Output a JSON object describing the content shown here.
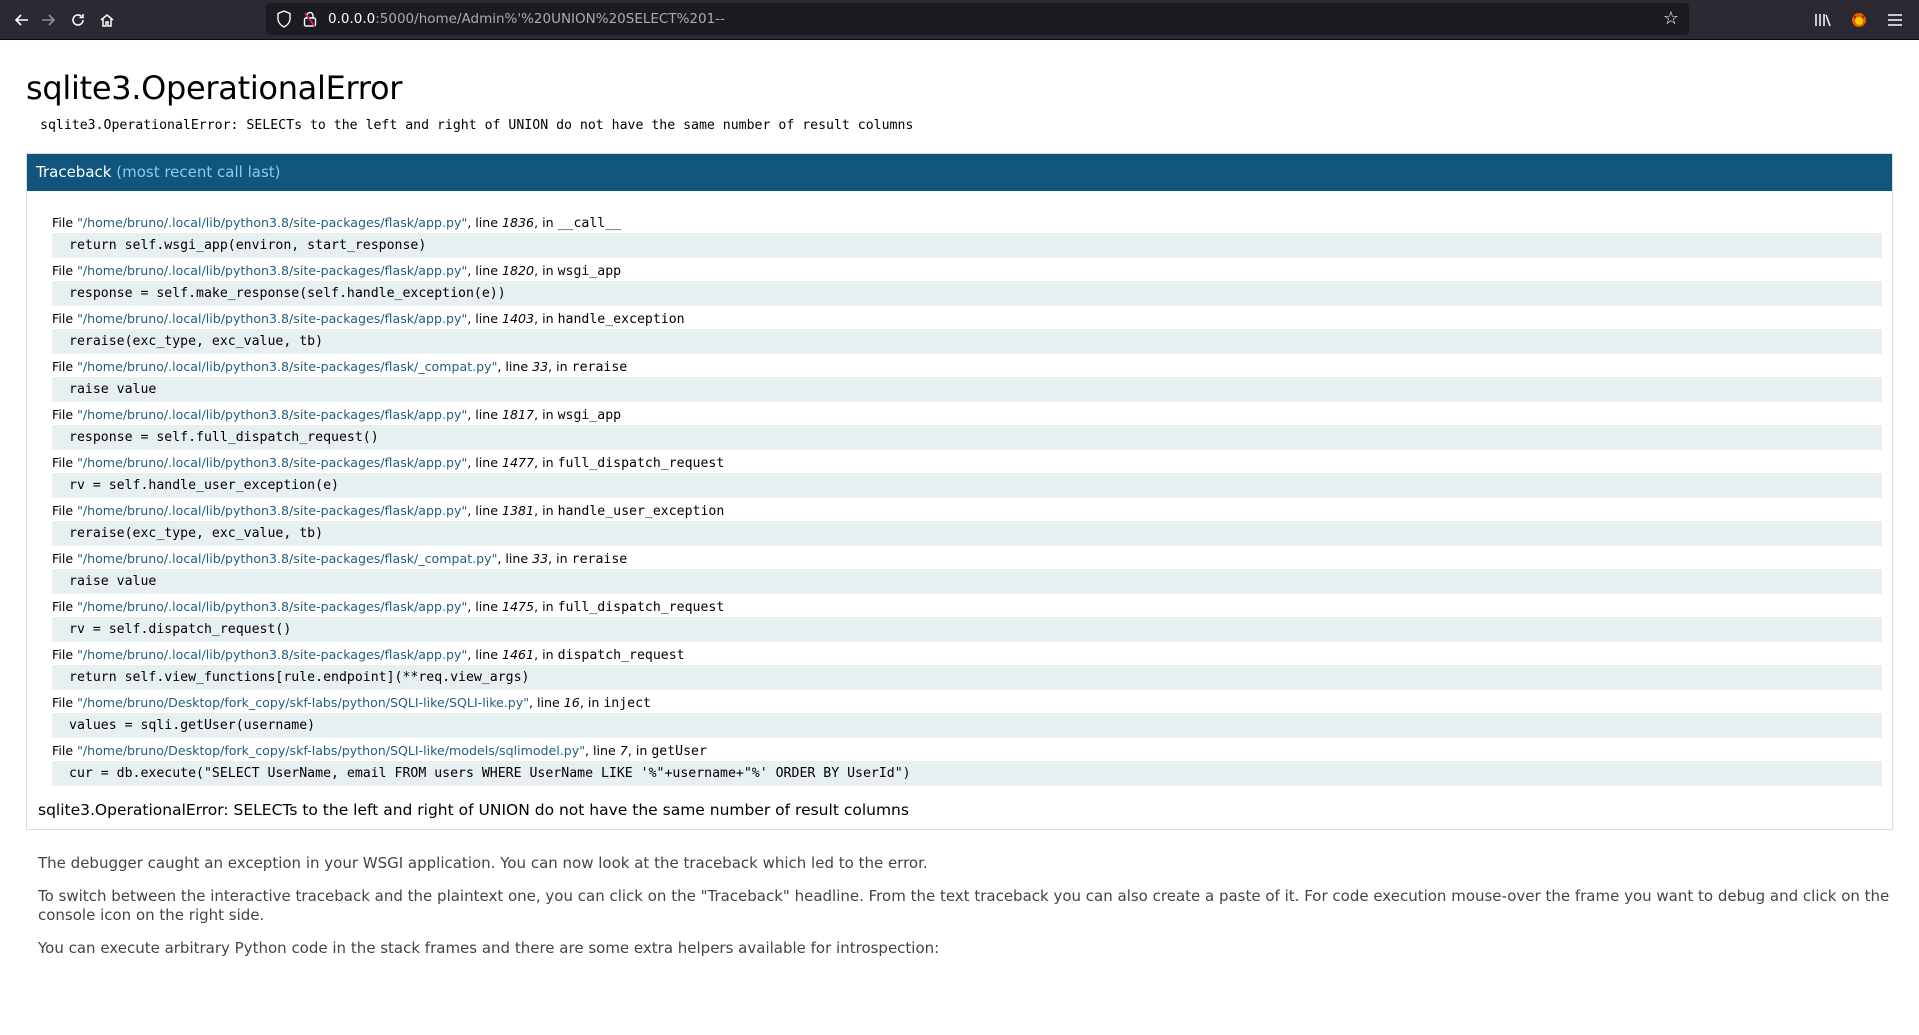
{
  "browser": {
    "url_host": "0.0.0.0",
    "url_rest": ":5000/home/Admin%'%20UNION%20SELECT%201--"
  },
  "page": {
    "title": "sqlite3.OperationalError",
    "error_message": "sqlite3.OperationalError: SELECTs to the left and right of UNION do not have the same number of result columns"
  },
  "traceback": {
    "header": "Traceback",
    "header_sub": "(most recent call last)",
    "frames": [
      {
        "file": "\"/home/bruno/.local/lib/python3.8/site-packages/flask/app.py\"",
        "line": "1836",
        "func": "__call__",
        "source": "return self.wsgi_app(environ, start_response)"
      },
      {
        "file": "\"/home/bruno/.local/lib/python3.8/site-packages/flask/app.py\"",
        "line": "1820",
        "func": "wsgi_app",
        "source": "response = self.make_response(self.handle_exception(e))"
      },
      {
        "file": "\"/home/bruno/.local/lib/python3.8/site-packages/flask/app.py\"",
        "line": "1403",
        "func": "handle_exception",
        "source": "reraise(exc_type, exc_value, tb)"
      },
      {
        "file": "\"/home/bruno/.local/lib/python3.8/site-packages/flask/_compat.py\"",
        "line": "33",
        "func": "reraise",
        "source": "raise value"
      },
      {
        "file": "\"/home/bruno/.local/lib/python3.8/site-packages/flask/app.py\"",
        "line": "1817",
        "func": "wsgi_app",
        "source": "response = self.full_dispatch_request()"
      },
      {
        "file": "\"/home/bruno/.local/lib/python3.8/site-packages/flask/app.py\"",
        "line": "1477",
        "func": "full_dispatch_request",
        "source": "rv = self.handle_user_exception(e)"
      },
      {
        "file": "\"/home/bruno/.local/lib/python3.8/site-packages/flask/app.py\"",
        "line": "1381",
        "func": "handle_user_exception",
        "source": "reraise(exc_type, exc_value, tb)"
      },
      {
        "file": "\"/home/bruno/.local/lib/python3.8/site-packages/flask/_compat.py\"",
        "line": "33",
        "func": "reraise",
        "source": "raise value"
      },
      {
        "file": "\"/home/bruno/.local/lib/python3.8/site-packages/flask/app.py\"",
        "line": "1475",
        "func": "full_dispatch_request",
        "source": "rv = self.dispatch_request()"
      },
      {
        "file": "\"/home/bruno/.local/lib/python3.8/site-packages/flask/app.py\"",
        "line": "1461",
        "func": "dispatch_request",
        "source": "return self.view_functions[rule.endpoint](**req.view_args)"
      },
      {
        "file": "\"/home/bruno/Desktop/fork_copy/skf-labs/python/SQLI-like/SQLI-like.py\"",
        "line": "16",
        "func": "inject",
        "source": "values = sqli.getUser(username)"
      },
      {
        "file": "\"/home/bruno/Desktop/fork_copy/skf-labs/python/SQLI-like/models/sqlimodel.py\"",
        "line": "7",
        "func": "getUser",
        "source": "cur = db.execute(\"SELECT UserName, email FROM users WHERE UserName LIKE '%\"+username+\"%' ORDER BY UserId\")"
      }
    ],
    "final_error": "sqlite3.OperationalError: SELECTs to the left and right of UNION do not have the same number of result columns"
  },
  "explanation": {
    "p1": "The debugger caught an exception in your WSGI application. You can now look at the traceback which led to the error.",
    "p2": "To switch between the interactive traceback and the plaintext one, you can click on the \"Traceback\" headline. From the text traceback you can also create a paste of it. For code execution mouse-over the frame you want to debug and click on the console icon on the right side.",
    "p3": "You can execute arbitrary Python code in the stack frames and there are some extra helpers available for introspection:"
  },
  "labels": {
    "file_prefix": "File ",
    "line_prefix": ", line ",
    "in_prefix": ", in "
  }
}
